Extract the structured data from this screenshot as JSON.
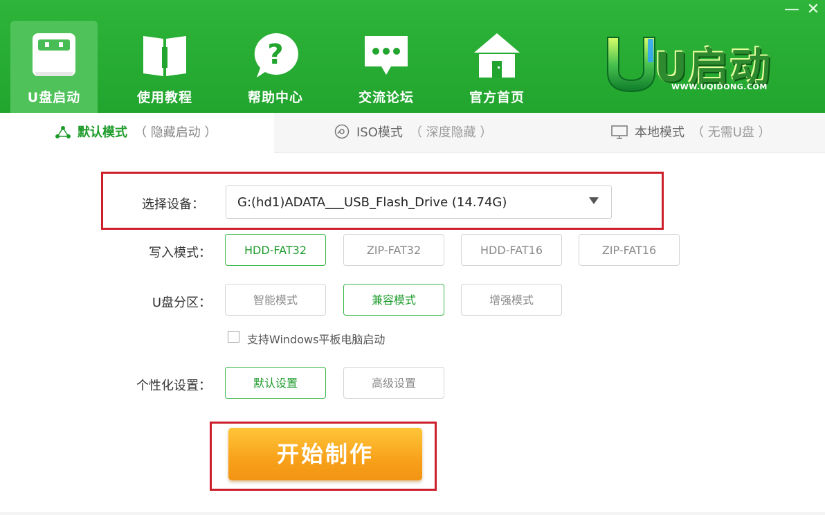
{
  "window": {
    "minimize_icon": "minimize-icon",
    "close_icon": "close-icon",
    "minimize_glyph": "—",
    "close_glyph": "✕"
  },
  "nav": {
    "items": [
      {
        "label": "U盘启动",
        "icon": "usb-drive-icon"
      },
      {
        "label": "使用教程",
        "icon": "book-icon"
      },
      {
        "label": "帮助中心",
        "icon": "question-bubble-icon"
      },
      {
        "label": "交流论坛",
        "icon": "chat-bubble-icon"
      },
      {
        "label": "官方首页",
        "icon": "home-icon"
      }
    ],
    "active_index": 0
  },
  "logo": {
    "text": "U启动",
    "url": "WWW.UQIDONG.COM"
  },
  "modes": [
    {
      "label": "默认模式",
      "sub": "（ 隐藏启动 ）",
      "icon": "share-nodes-icon",
      "active": true
    },
    {
      "label": "ISO模式",
      "sub": "（ 深度隐藏 ）",
      "icon": "disc-icon",
      "active": false
    },
    {
      "label": "本地模式",
      "sub": "（ 无需U盘 ）",
      "icon": "monitor-icon",
      "active": false
    }
  ],
  "form": {
    "device_label": "选择设备：",
    "device_value": "G:(hd1)ADATA___USB_Flash_Drive (14.74G)",
    "write_mode_label": "写入模式：",
    "write_modes": [
      "HDD-FAT32",
      "ZIP-FAT32",
      "HDD-FAT16",
      "ZIP-FAT16"
    ],
    "write_mode_selected": 0,
    "partition_label": "U盘分区：",
    "partition_modes": [
      "智能模式",
      "兼容模式",
      "增强模式"
    ],
    "partition_selected": 1,
    "tablet_checkbox_label": "支持Windows平板电脑启动",
    "tablet_checked": false,
    "personal_label": "个性化设置：",
    "personal_options": [
      "默认设置",
      "高级设置"
    ],
    "personal_selected": 0,
    "start_button": "开始制作"
  },
  "colors": {
    "header_green": "#21a52e",
    "accent_green": "#1e9b2b",
    "highlight_red": "#cc1f2a",
    "button_orange": "#f8a11a"
  }
}
